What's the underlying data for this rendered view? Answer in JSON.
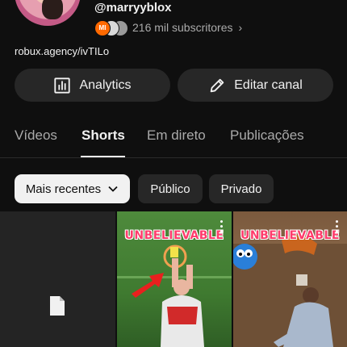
{
  "channel": {
    "handle": "@marryyblox",
    "badge_label": "MI",
    "subscribers": "216 mil subscritores",
    "link": "robux.agency/ivTILo"
  },
  "actions": {
    "analytics_label": "Analytics",
    "edit_label": "Editar canal"
  },
  "tabs": [
    {
      "label": "Vídeos",
      "active": false
    },
    {
      "label": "Shorts",
      "active": true
    },
    {
      "label": "Em direto",
      "active": false
    },
    {
      "label": "Publicações",
      "active": false
    }
  ],
  "filters": {
    "selected": "Mais recentes",
    "options": [
      "Público",
      "Privado"
    ]
  },
  "shorts": [
    {
      "overlay_text": ""
    },
    {
      "overlay_text": "UNBELIEVABLE"
    },
    {
      "overlay_text": "UNBELIEVABLE"
    }
  ],
  "colors": {
    "background": "#0f0f0f",
    "surface": "#272727",
    "text": "#f1f1f1",
    "muted": "#aaaaaa",
    "overlay_text": "#ff3b6b"
  }
}
